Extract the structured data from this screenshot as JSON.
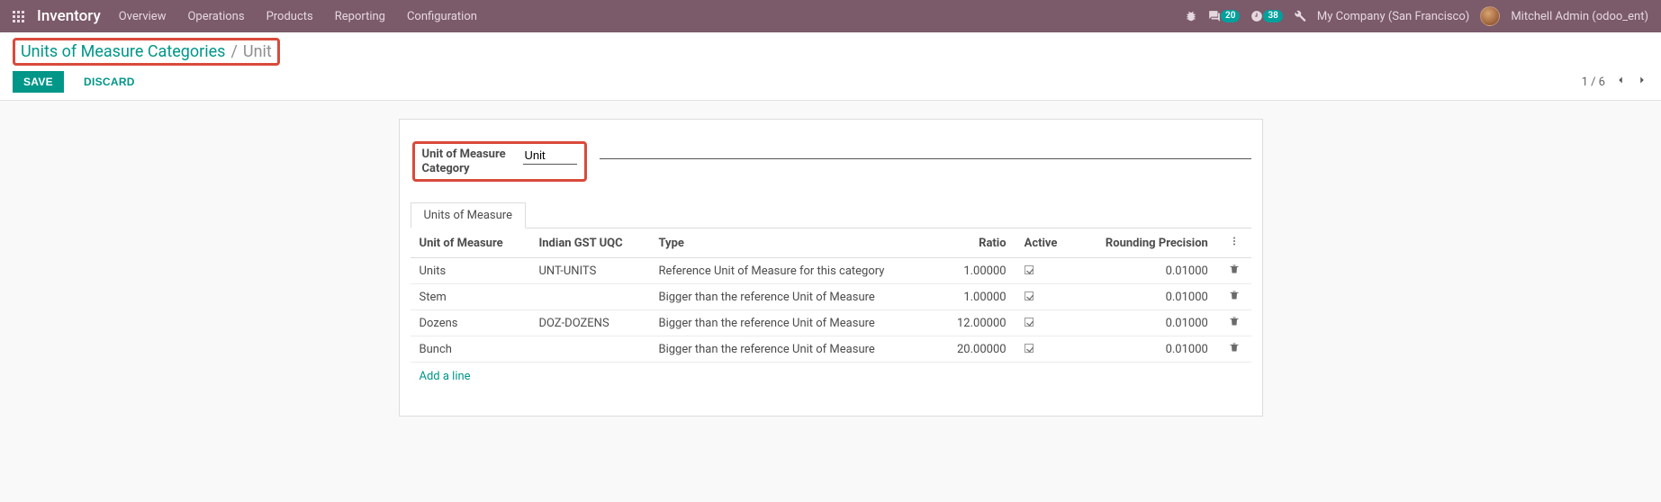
{
  "nav": {
    "app": "Inventory",
    "menu": [
      "Overview",
      "Operations",
      "Products",
      "Reporting",
      "Configuration"
    ],
    "msg_count": "20",
    "activity_count": "38",
    "company": "My Company (San Francisco)",
    "user": "Mitchell Admin (odoo_ent)"
  },
  "breadcrumb": {
    "parent": "Units of Measure Categories",
    "current": "Unit"
  },
  "buttons": {
    "save": "SAVE",
    "discard": "DISCARD"
  },
  "pager": {
    "text": "1 / 6"
  },
  "form": {
    "label": "Unit of Measure Category",
    "value": "Unit"
  },
  "tab": {
    "label": "Units of Measure"
  },
  "columns": {
    "uom": "Unit of Measure",
    "uqc": "Indian GST UQC",
    "type": "Type",
    "ratio": "Ratio",
    "active": "Active",
    "rounding": "Rounding Precision"
  },
  "rows": [
    {
      "uom": "Units",
      "uqc": "UNT-UNITS",
      "type": "Reference Unit of Measure for this category",
      "ratio": "1.00000",
      "active": true,
      "rounding": "0.01000"
    },
    {
      "uom": "Stem",
      "uqc": "",
      "type": "Bigger than the reference Unit of Measure",
      "ratio": "1.00000",
      "active": true,
      "rounding": "0.01000"
    },
    {
      "uom": "Dozens",
      "uqc": "DOZ-DOZENS",
      "type": "Bigger than the reference Unit of Measure",
      "ratio": "12.00000",
      "active": true,
      "rounding": "0.01000"
    },
    {
      "uom": "Bunch",
      "uqc": "",
      "type": "Bigger than the reference Unit of Measure",
      "ratio": "20.00000",
      "active": true,
      "rounding": "0.01000"
    }
  ],
  "add_line": "Add a line"
}
